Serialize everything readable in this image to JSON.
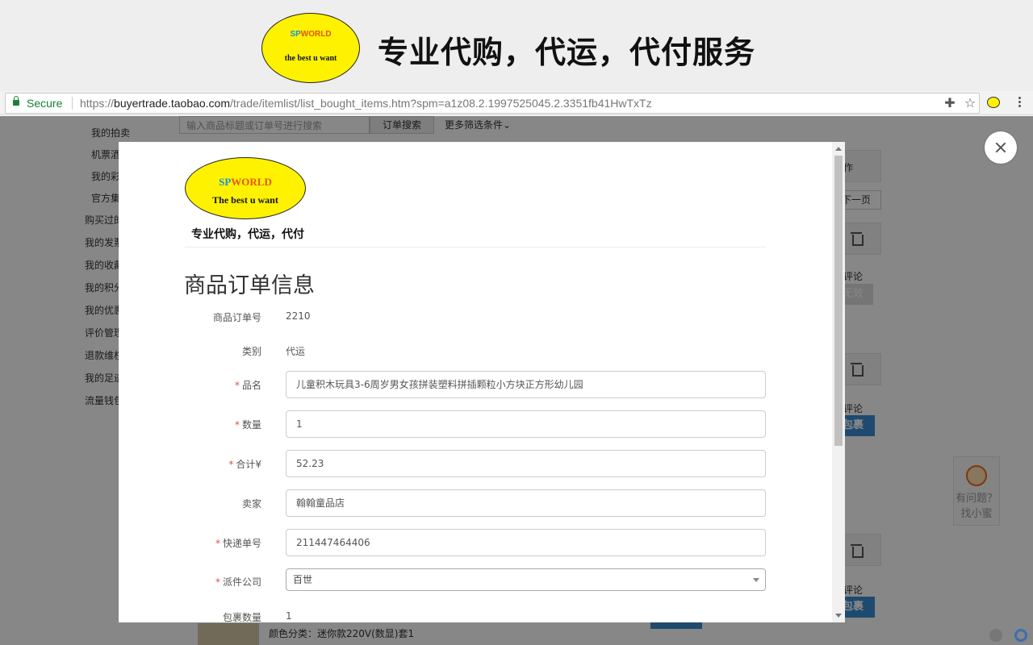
{
  "banner": {
    "logo_sp": "SP",
    "logo_world": "WORLD",
    "logo_tagline": "the best u want",
    "slogan": "专业代购，代运，代付服务"
  },
  "browser": {
    "secure_label": "Secure",
    "url_scheme": "https://",
    "url_host": "buyertrade.taobao.com",
    "url_path": "/trade/itemlist/list_bought_items.htm?spm=a1z08.2.1997525045.2.3351fb41HwTxTz",
    "icons": [
      "puzzle-icon",
      "star-icon",
      "extension-logo-icon",
      "menu-icon"
    ]
  },
  "background_page": {
    "sidebar": [
      "我的拍卖",
      "机票酒",
      "我的彩",
      "官方集",
      "购买过的",
      "我的发票",
      "我的收藏",
      "我的积分",
      "我的优惠",
      "评价管理",
      "退款维权",
      "我的足迹",
      "流量钱包"
    ],
    "search_placeholder": "输入商品标题或订单号进行搜索",
    "search_button": "订单搜索",
    "more_filters": "更多筛选条件",
    "right_labels": {
      "operation": "作",
      "next_page": "下一页",
      "review1": "评论",
      "invalid_btn": "无效",
      "review2": "评论",
      "package_btn1": "包裹",
      "review3": "评论",
      "package_btn2": "包裹"
    },
    "helper_line1": "有问题？",
    "helper_line2": "找小蜜",
    "bottom_item_text": "颜色分类：迷你款220V(数显)套1"
  },
  "modal": {
    "logo_sp": "SP",
    "logo_world": "WORLD",
    "logo_tagline": "The best u want",
    "slogan": "专业代购，代运，代付",
    "title": "商品订单信息",
    "fields": {
      "order_no": {
        "label": "商品订单号",
        "value": "2210"
      },
      "category": {
        "label": "类别",
        "value": "代运"
      },
      "product_name": {
        "label": "品名",
        "value": "儿童积木玩具3-6周岁男女孩拼装塑料拼插颗粒小方块正方形幼儿园"
      },
      "quantity": {
        "label": "数量",
        "value": "1"
      },
      "total": {
        "label": "合计¥",
        "value": "52.23"
      },
      "seller": {
        "label": "卖家",
        "value": "翰翰童品店"
      },
      "tracking_no": {
        "label": "快递单号",
        "value": "211447464406"
      },
      "courier": {
        "label": "派件公司",
        "value": "百世"
      },
      "package_count": {
        "label": "包裹数量",
        "value": "1"
      }
    }
  },
  "colors": {
    "logo_yellow": "#fff200",
    "secure_green": "#188038",
    "required_red": "#d9534f",
    "action_blue": "#3c8dd2"
  }
}
